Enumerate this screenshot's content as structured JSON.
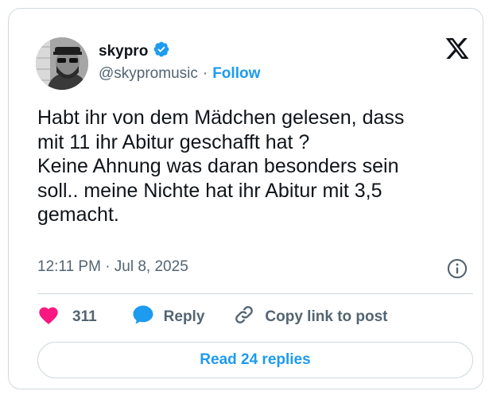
{
  "author": {
    "name": "skypro",
    "handle": "@skypromusic",
    "separator": "·",
    "follow_label": "Follow",
    "verified_icon": "verified-badge-icon",
    "avatar_icon": "profile-avatar"
  },
  "platform": {
    "logo_icon": "x-logo-icon"
  },
  "tweet": {
    "lines": [
      "Habt ihr von dem Mädchen gelesen, dass",
      "mit 11 ihr Abitur geschafft hat ?",
      "Keine Ahnung was daran besonders sein",
      "soll.. meine Nichte hat ihr Abitur mit 3,5",
      "gemacht."
    ],
    "timestamp": "12:11 PM · Jul 8, 2025",
    "info_icon": "info-icon"
  },
  "actions": {
    "like_count": "311",
    "reply_label": "Reply",
    "copy_label": "Copy link to post"
  },
  "footer": {
    "read_replies_label": "Read 24 replies"
  },
  "colors": {
    "accent": "#1d9bf0",
    "like": "#f91880",
    "text": "#0f1419",
    "muted": "#536471",
    "border": "#cfd9de"
  }
}
